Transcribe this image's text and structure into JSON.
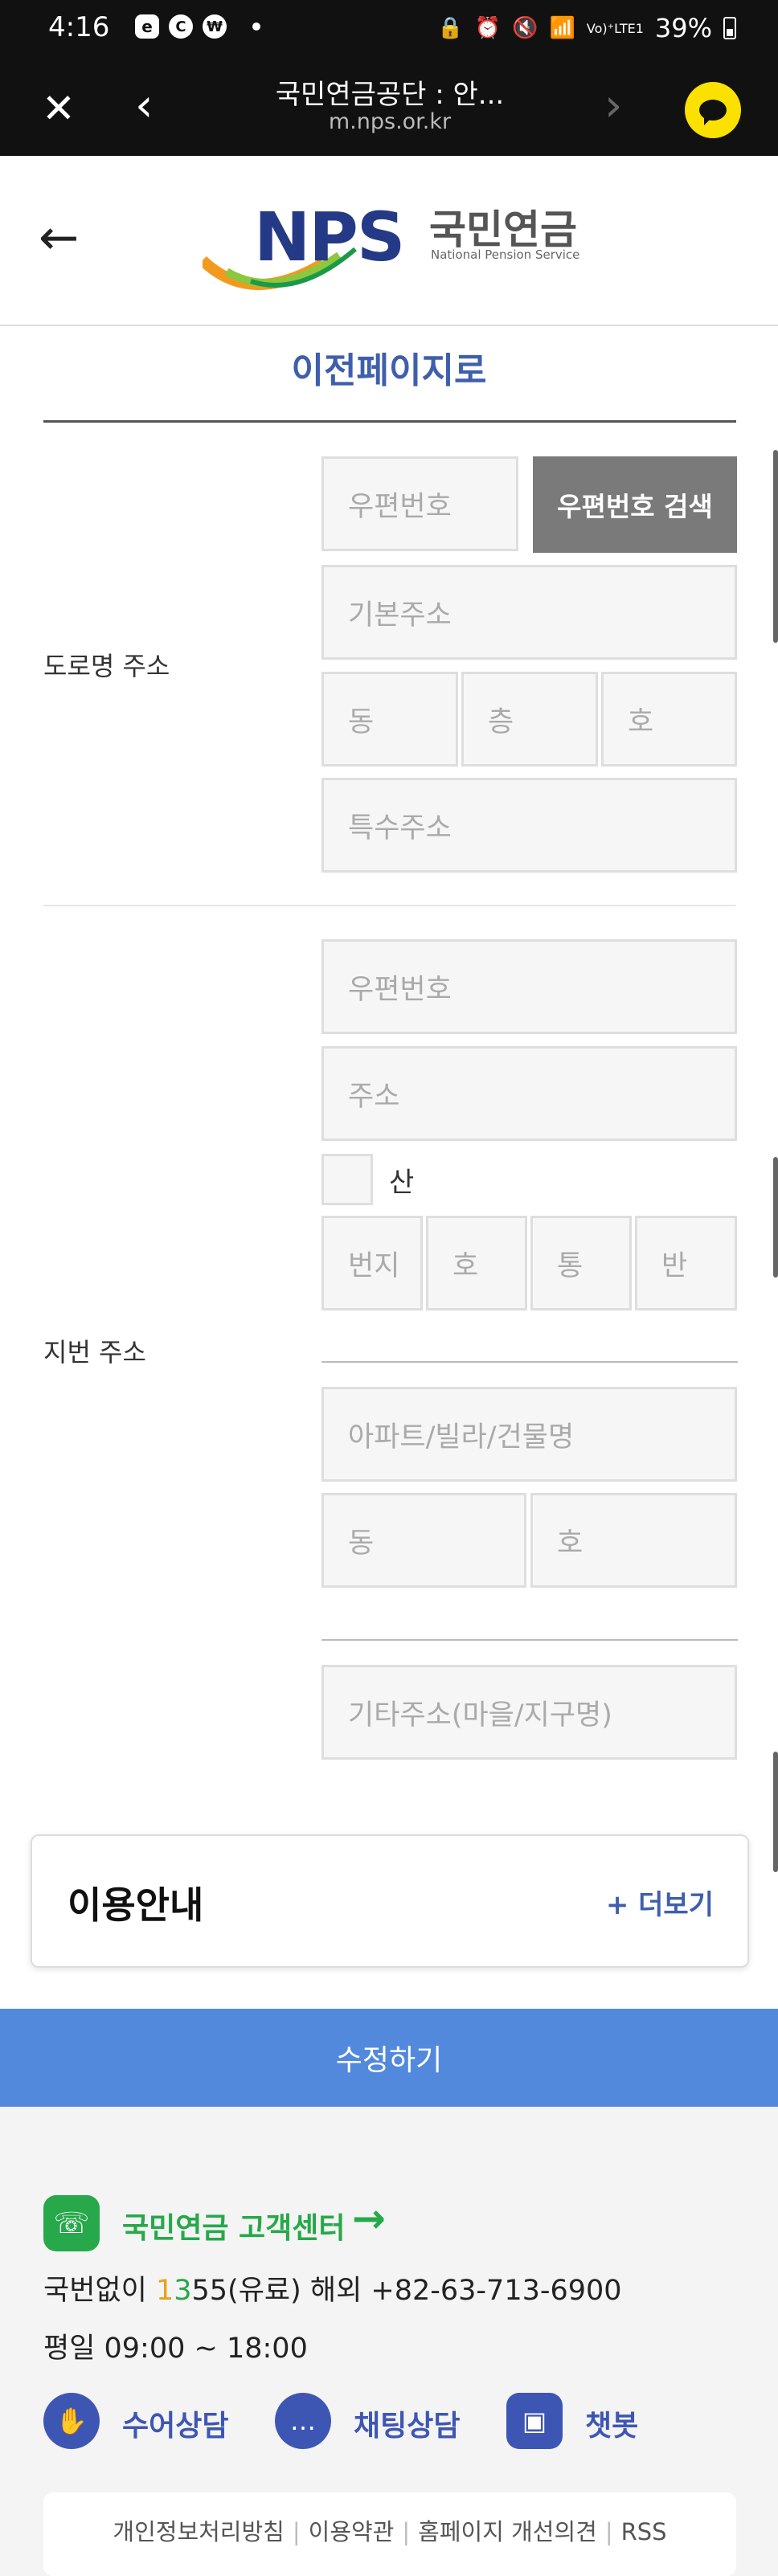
{
  "status_bar": {
    "time": "4:16",
    "battery": "39%",
    "net": "Vo)⁺LTE1"
  },
  "browser": {
    "title": "국민연금공단 : 안...",
    "url": "m.nps.or.kr"
  },
  "logo": {
    "main": "NPS",
    "korean": "국민연금",
    "english": "National Pension Service"
  },
  "prev_page_link": "이전페이지로",
  "road_address": {
    "label": "도로명 주소",
    "postcode_placeholder": "우편번호",
    "search_button": "우편번호 검색",
    "basic_placeholder": "기본주소",
    "dong_placeholder": "동",
    "floor_placeholder": "층",
    "ho_placeholder": "호",
    "special_placeholder": "특수주소"
  },
  "lot_address": {
    "label": "지번 주소",
    "postcode_placeholder": "우편번호",
    "address_placeholder": "주소",
    "mountain_checkbox_label": "산",
    "bunji_placeholder": "번지",
    "ho_placeholder": "호",
    "tong_placeholder": "통",
    "ban_placeholder": "반",
    "building_placeholder": "아파트/빌라/건물명",
    "dong_placeholder": "동",
    "unit_placeholder": "호",
    "etc_placeholder": "기타주소(마을/지구명)"
  },
  "guide": {
    "title": "이용안내",
    "more": "+ 더보기"
  },
  "submit_button": "수정하기",
  "footer": {
    "customer_center": "국민연금 고객센터",
    "phone_prefix": "국번없이 ",
    "phone_digit_1": "1",
    "phone_digit_2": "3",
    "phone_rest": "55(유료) 해외 +82-63-713-6900",
    "hours": "평일 09:00 ~ 18:00",
    "sign_language": "수어상담",
    "chat": "채팅상담",
    "chatbot": "챗봇",
    "links": [
      "개인정보처리방침",
      "이용약관",
      "홈페이지 개선의견",
      "RSS"
    ]
  },
  "colors": {
    "brand_blue": "#3f5fad",
    "button_blue": "#5289dd",
    "green": "#27a84a",
    "gray_button": "#7a7a7a"
  }
}
